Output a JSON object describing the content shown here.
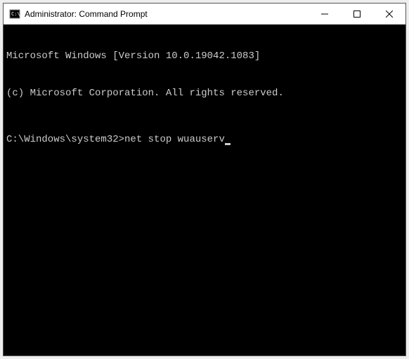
{
  "window": {
    "title": "Administrator: Command Prompt"
  },
  "terminal": {
    "line1": "Microsoft Windows [Version 10.0.19042.1083]",
    "line2": "(c) Microsoft Corporation. All rights reserved.",
    "prompt": "C:\\Windows\\system32>",
    "command": "net stop wuauserv"
  }
}
